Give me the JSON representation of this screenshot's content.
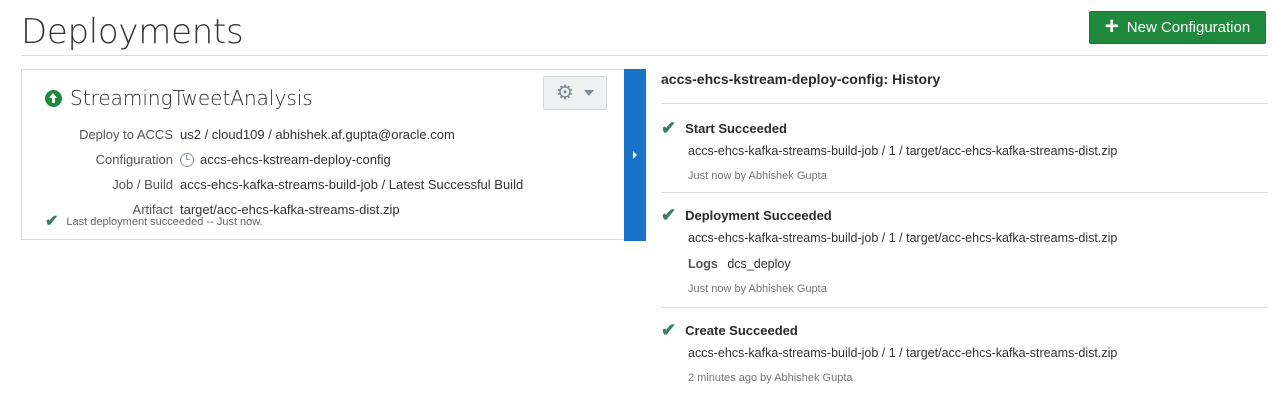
{
  "header": {
    "title": "Deployments",
    "new_config_label": "New Configuration",
    "accent": "#1f8a3c"
  },
  "deployment": {
    "name": "StreamingTweetAnalysis",
    "rows": [
      {
        "label": "Deploy to ACCS",
        "value": "us2 / cloud109 / abhishek.af.gupta@oracle.com"
      },
      {
        "label": "Configuration",
        "value": "accs-ehcs-kstream-deploy-config"
      },
      {
        "label": "Job / Build",
        "value": "accs-ehcs-kafka-streams-build-job / Latest Successful Build"
      },
      {
        "label": "Artifact",
        "value": "target/acc-ehcs-kafka-streams-dist.zip"
      }
    ],
    "status": "Last deployment succeeded -- Just now.",
    "toggle_color": "#1872c8"
  },
  "history": {
    "title": "accs-ehcs-kstream-deploy-config: History",
    "items": [
      {
        "title": "Start Succeeded",
        "path": "accs-ehcs-kafka-streams-build-job / 1 / target/acc-ehcs-kafka-streams-dist.zip",
        "meta": "Just now by Abhishek Gupta"
      },
      {
        "title": "Deployment Succeeded",
        "path": "accs-ehcs-kafka-streams-build-job / 1 / target/acc-ehcs-kafka-streams-dist.zip",
        "logs_label": "Logs",
        "logs_value": "dcs_deploy",
        "meta": "Just now by Abhishek Gupta"
      },
      {
        "title": "Create Succeeded",
        "path": "accs-ehcs-kafka-streams-build-job / 1 / target/acc-ehcs-kafka-streams-dist.zip",
        "meta": "2 minutes ago by Abhishek Gupta"
      }
    ]
  }
}
